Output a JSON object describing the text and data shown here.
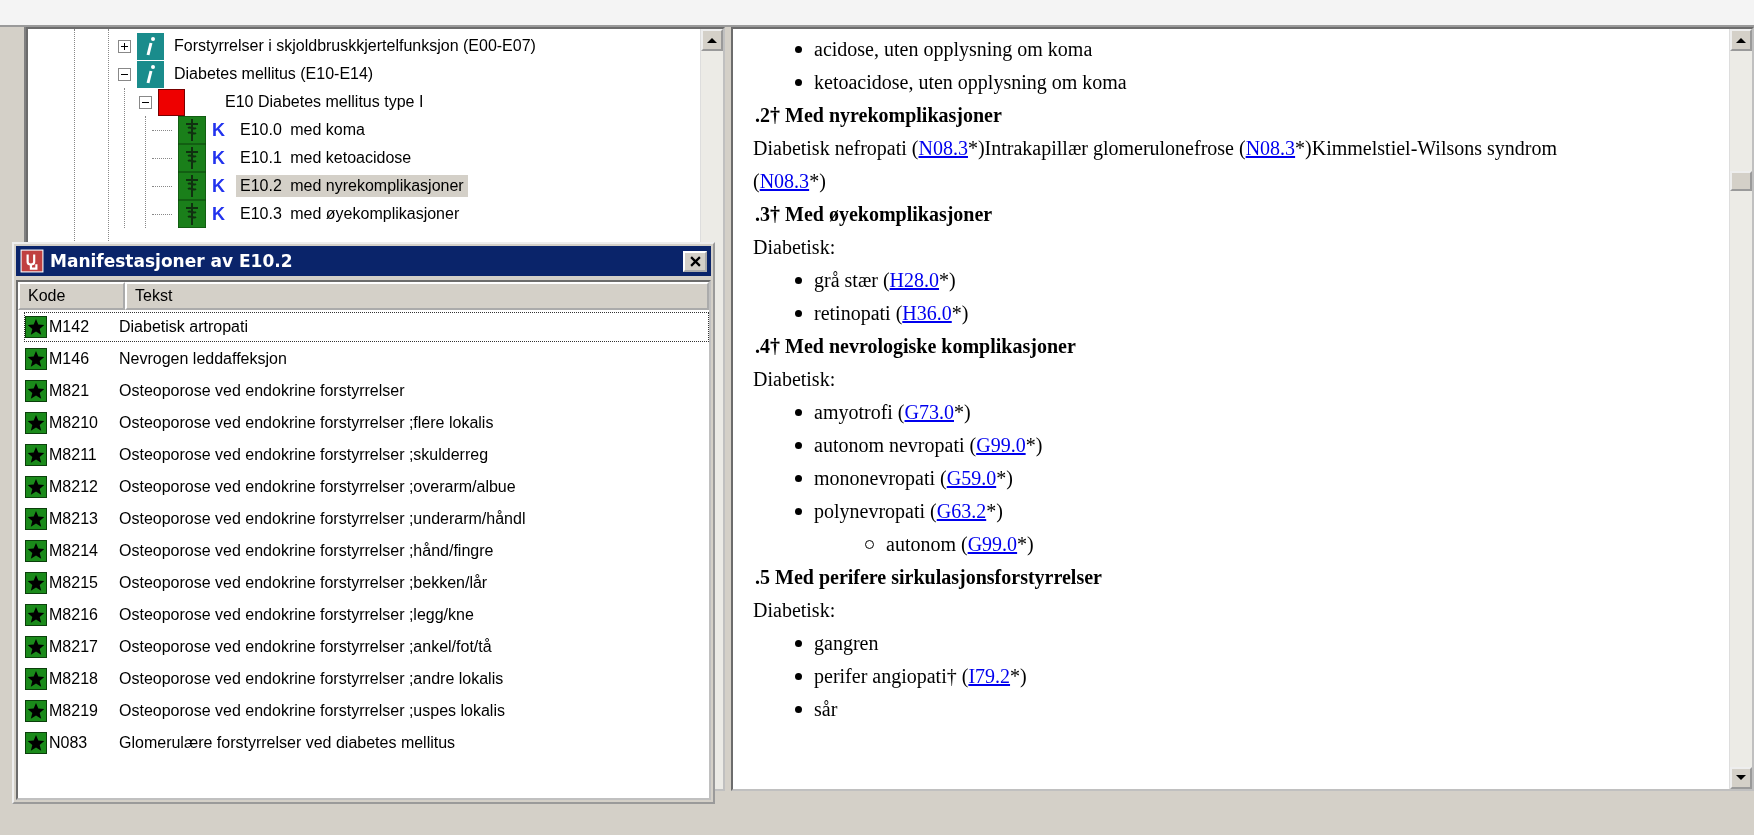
{
  "tree": {
    "items": [
      {
        "kind": "chapter",
        "label": "Forstyrrelser i skjoldbruskkjertelfunksjon (E00-E07)",
        "expanded": false,
        "selected": false
      },
      {
        "kind": "chapter",
        "label": "Diabetes mellitus (E10-E14)",
        "expanded": true,
        "selected": false,
        "children": [
          {
            "kind": "category",
            "label": "E10 Diabetes mellitus type I",
            "expanded": true,
            "selected": false,
            "children": [
              {
                "kind": "code",
                "badge": "K",
                "code": "E10.0",
                "label": "med koma",
                "selected": false
              },
              {
                "kind": "code",
                "badge": "K",
                "code": "E10.1",
                "label": "med ketoacidose",
                "selected": false
              },
              {
                "kind": "code",
                "badge": "K",
                "code": "E10.2",
                "label": "med nyrekomplikasjoner",
                "selected": true
              },
              {
                "kind": "code",
                "badge": "K",
                "code": "E10.3",
                "label": "med øyekomplikasjoner",
                "selected": false
              }
            ]
          }
        ]
      }
    ]
  },
  "dialog": {
    "title": "Manifestasjoner av E10.2",
    "columns": [
      "Kode",
      "Tekst"
    ],
    "rows": [
      {
        "code": "M142",
        "text": "Diabetisk artropati",
        "selected": true
      },
      {
        "code": "M146",
        "text": "Nevrogen leddaffeksjon",
        "selected": false
      },
      {
        "code": "M821",
        "text": "Osteoporose ved endokrine forstyrrelser",
        "selected": false
      },
      {
        "code": "M8210",
        "text": "Osteoporose ved endokrine forstyrrelser ;flere lokalis",
        "selected": false
      },
      {
        "code": "M8211",
        "text": "Osteoporose ved endokrine forstyrrelser ;skulderreg",
        "selected": false
      },
      {
        "code": "M8212",
        "text": "Osteoporose ved endokrine forstyrrelser ;overarm/albue",
        "selected": false
      },
      {
        "code": "M8213",
        "text": "Osteoporose ved endokrine forstyrrelser ;underarm/håndl",
        "selected": false
      },
      {
        "code": "M8214",
        "text": "Osteoporose ved endokrine forstyrrelser ;hånd/fingre",
        "selected": false
      },
      {
        "code": "M8215",
        "text": "Osteoporose ved endokrine forstyrrelser ;bekken/lår",
        "selected": false
      },
      {
        "code": "M8216",
        "text": "Osteoporose ved endokrine forstyrrelser ;legg/kne",
        "selected": false
      },
      {
        "code": "M8217",
        "text": "Osteoporose ved endokrine forstyrrelser ;ankel/fot/tå",
        "selected": false
      },
      {
        "code": "M8218",
        "text": "Osteoporose ved endokrine forstyrrelser ;andre lokalis",
        "selected": false
      },
      {
        "code": "M8219",
        "text": "Osteoporose ved endokrine forstyrrelser ;uspes lokalis",
        "selected": false
      },
      {
        "code": "N083",
        "text": "Glomerulære forstyrrelser ved diabetes mellitus",
        "selected": false
      }
    ]
  },
  "document": {
    "blocks": [
      {
        "kind": "bullet",
        "parts": [
          {
            "kind": "text",
            "text": "acidose, uten opplysning om koma"
          }
        ]
      },
      {
        "kind": "bullet",
        "parts": [
          {
            "kind": "text",
            "text": "ketoacidose, uten opplysning om koma"
          }
        ]
      },
      {
        "kind": "heading",
        "parts": [
          {
            "kind": "text",
            "text": ".2† Med nyrekomplikasjoner"
          }
        ]
      },
      {
        "kind": "para",
        "parts": [
          {
            "kind": "text",
            "text": "Diabetisk nefropati ("
          },
          {
            "kind": "link",
            "text": "N08.3"
          },
          {
            "kind": "text",
            "text": "*)Intrakapillær glomerulonefrose ("
          },
          {
            "kind": "link",
            "text": "N08.3"
          },
          {
            "kind": "text",
            "text": "*)Kimmelstiel-Wilsons syndrom ("
          },
          {
            "kind": "link",
            "text": "N08.3"
          },
          {
            "kind": "text",
            "text": "*)"
          }
        ]
      },
      {
        "kind": "heading",
        "parts": [
          {
            "kind": "text",
            "text": ".3† Med øyekomplikasjoner"
          }
        ]
      },
      {
        "kind": "para",
        "parts": [
          {
            "kind": "text",
            "text": "Diabetisk:"
          }
        ]
      },
      {
        "kind": "bullet",
        "parts": [
          {
            "kind": "text",
            "text": "grå stær ("
          },
          {
            "kind": "link",
            "text": "H28.0"
          },
          {
            "kind": "text",
            "text": "*)"
          }
        ]
      },
      {
        "kind": "bullet",
        "parts": [
          {
            "kind": "text",
            "text": "retinopati ("
          },
          {
            "kind": "link",
            "text": "H36.0"
          },
          {
            "kind": "text",
            "text": "*)"
          }
        ]
      },
      {
        "kind": "heading",
        "parts": [
          {
            "kind": "text",
            "text": ".4† Med nevrologiske komplikasjoner"
          }
        ]
      },
      {
        "kind": "para",
        "parts": [
          {
            "kind": "text",
            "text": "Diabetisk:"
          }
        ]
      },
      {
        "kind": "bullet",
        "parts": [
          {
            "kind": "text",
            "text": "amyotrofi ("
          },
          {
            "kind": "link",
            "text": "G73.0"
          },
          {
            "kind": "text",
            "text": "*)"
          }
        ]
      },
      {
        "kind": "bullet",
        "parts": [
          {
            "kind": "text",
            "text": "autonom nevropati ("
          },
          {
            "kind": "link",
            "text": "G99.0"
          },
          {
            "kind": "text",
            "text": "*)"
          }
        ]
      },
      {
        "kind": "bullet",
        "parts": [
          {
            "kind": "text",
            "text": "mononevropati ("
          },
          {
            "kind": "link",
            "text": "G59.0"
          },
          {
            "kind": "text",
            "text": "*)"
          }
        ]
      },
      {
        "kind": "bullet",
        "parts": [
          {
            "kind": "text",
            "text": "polynevropati ("
          },
          {
            "kind": "link",
            "text": "G63.2"
          },
          {
            "kind": "text",
            "text": "*)"
          }
        ]
      },
      {
        "kind": "subbullet",
        "parts": [
          {
            "kind": "text",
            "text": "autonom ("
          },
          {
            "kind": "link",
            "text": "G99.0"
          },
          {
            "kind": "text",
            "text": "*)"
          }
        ]
      },
      {
        "kind": "heading",
        "parts": [
          {
            "kind": "text",
            "text": ".5 Med perifere sirkulasjonsforstyrrelser"
          }
        ]
      },
      {
        "kind": "para",
        "parts": [
          {
            "kind": "text",
            "text": "Diabetisk:"
          }
        ]
      },
      {
        "kind": "bullet",
        "parts": [
          {
            "kind": "text",
            "text": "gangren"
          }
        ]
      },
      {
        "kind": "bullet",
        "parts": [
          {
            "kind": "text",
            "text": "perifer angiopati† ("
          },
          {
            "kind": "link",
            "text": "I79.2"
          },
          {
            "kind": "text",
            "text": "*)"
          }
        ]
      },
      {
        "kind": "bullet",
        "parts": [
          {
            "kind": "text",
            "text": "sår"
          }
        ]
      }
    ]
  }
}
